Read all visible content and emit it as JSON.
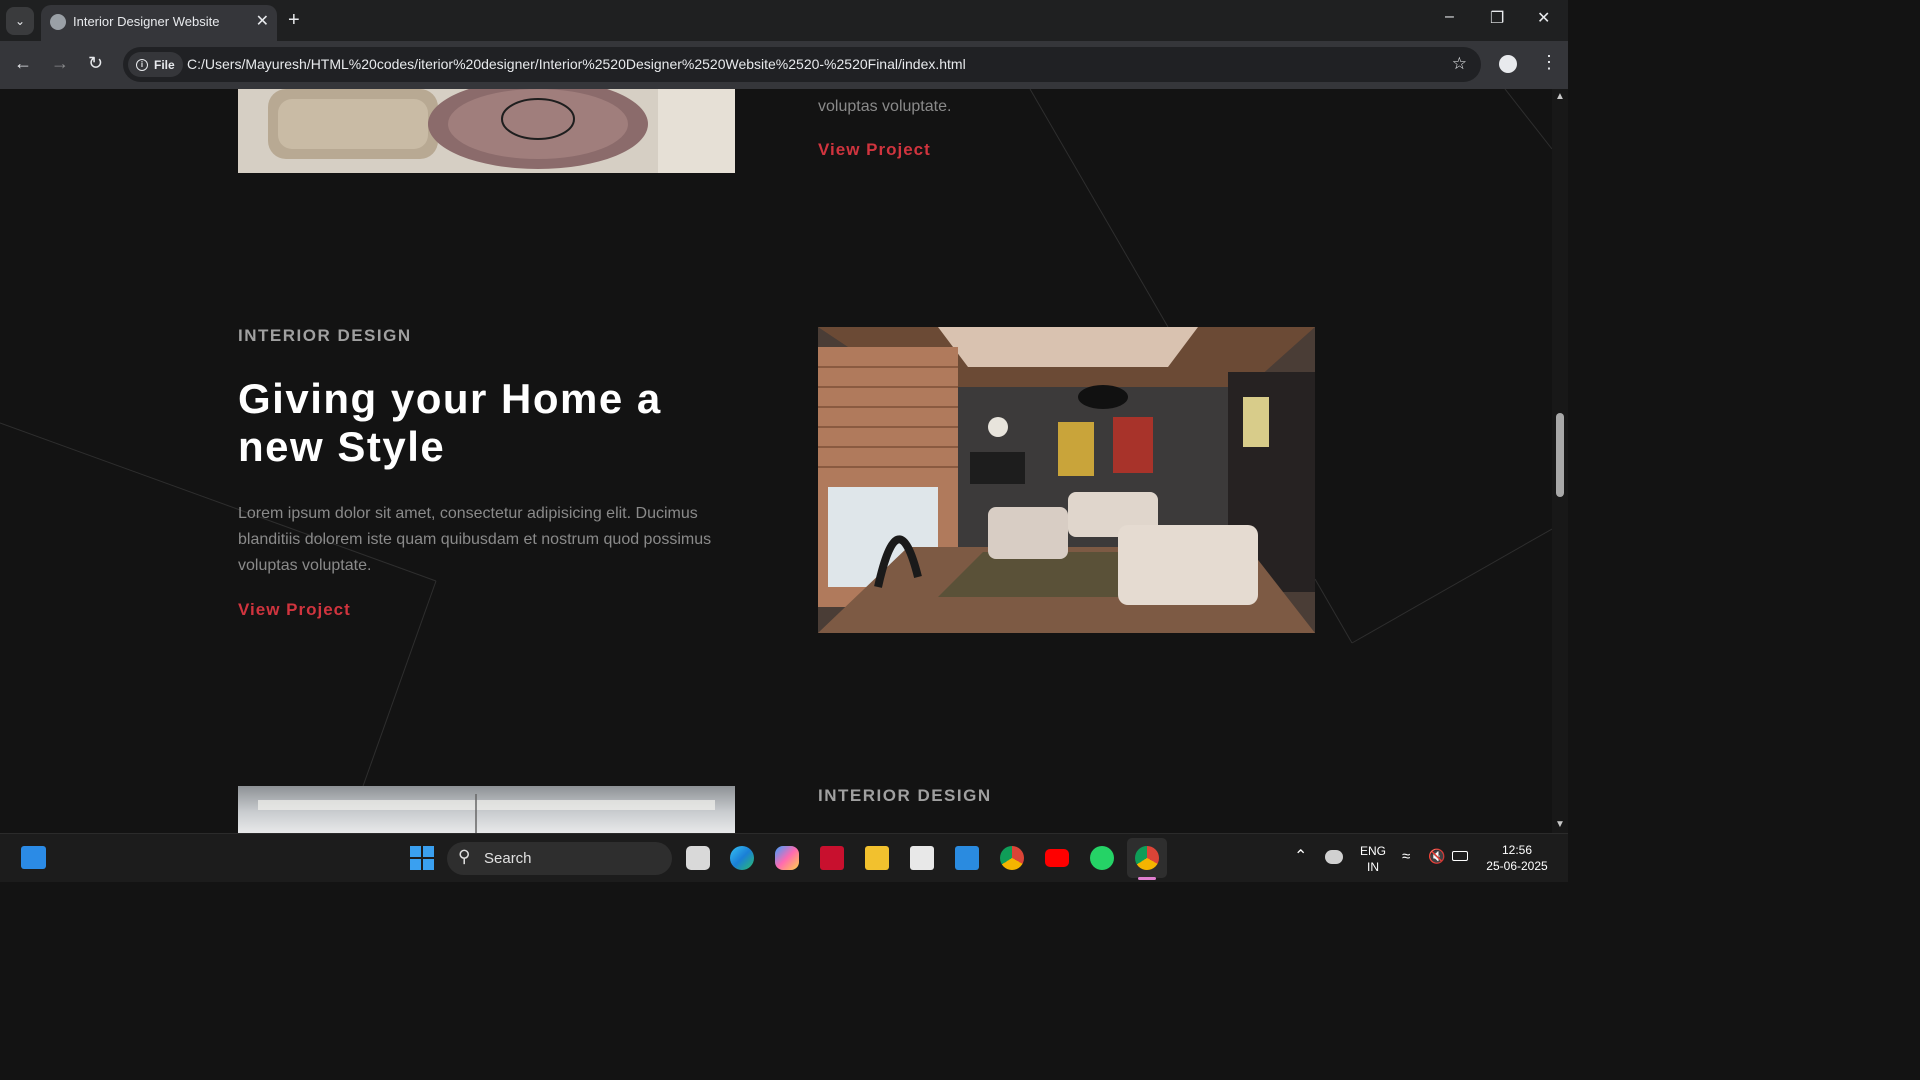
{
  "browser": {
    "tab_title": "Interior Designer Website",
    "file_chip": "File",
    "url": "C:/Users/Mayuresh/HTML%20codes/iterior%20designer/Interior%2520Designer%2520Website%2520-%2520Final/index.html"
  },
  "page": {
    "top_para_tail": "voluptas voluptate.",
    "top_link": "View Project",
    "section": {
      "eyebrow": "INTERIOR DESIGN",
      "heading": "Giving your Home a new Style",
      "paragraph": "Lorem ipsum dolor sit amet, consectetur adipisicing elit. Ducimus blanditiis dolorem iste quam quibusdam et nostrum quod possimus voluptas voluptate.",
      "link": "View Project"
    },
    "next_eyebrow": "INTERIOR DESIGN"
  },
  "taskbar": {
    "search_label": "Search",
    "lang_top": "ENG",
    "lang_bottom": "IN",
    "time": "12:56",
    "date": "25-06-2025"
  },
  "colors": {
    "accent_red": "#d0343e",
    "page_bg": "#131313"
  },
  "icons": [
    "tab-list-icon",
    "globe-icon",
    "close-icon",
    "plus-icon",
    "minimize-icon",
    "restore-icon",
    "back-icon",
    "forward-icon",
    "reload-icon",
    "info-icon",
    "star-icon",
    "profile-icon",
    "kebab-menu-icon",
    "windows-start-icon",
    "search-icon",
    "task-view-icon",
    "edge-icon",
    "copilot-icon",
    "mcafee-icon",
    "file-explorer-icon",
    "store-icon",
    "vscode-icon",
    "chrome-icon",
    "youtube-icon",
    "whatsapp-icon",
    "wifi-icon",
    "mute-icon",
    "battery-icon"
  ]
}
